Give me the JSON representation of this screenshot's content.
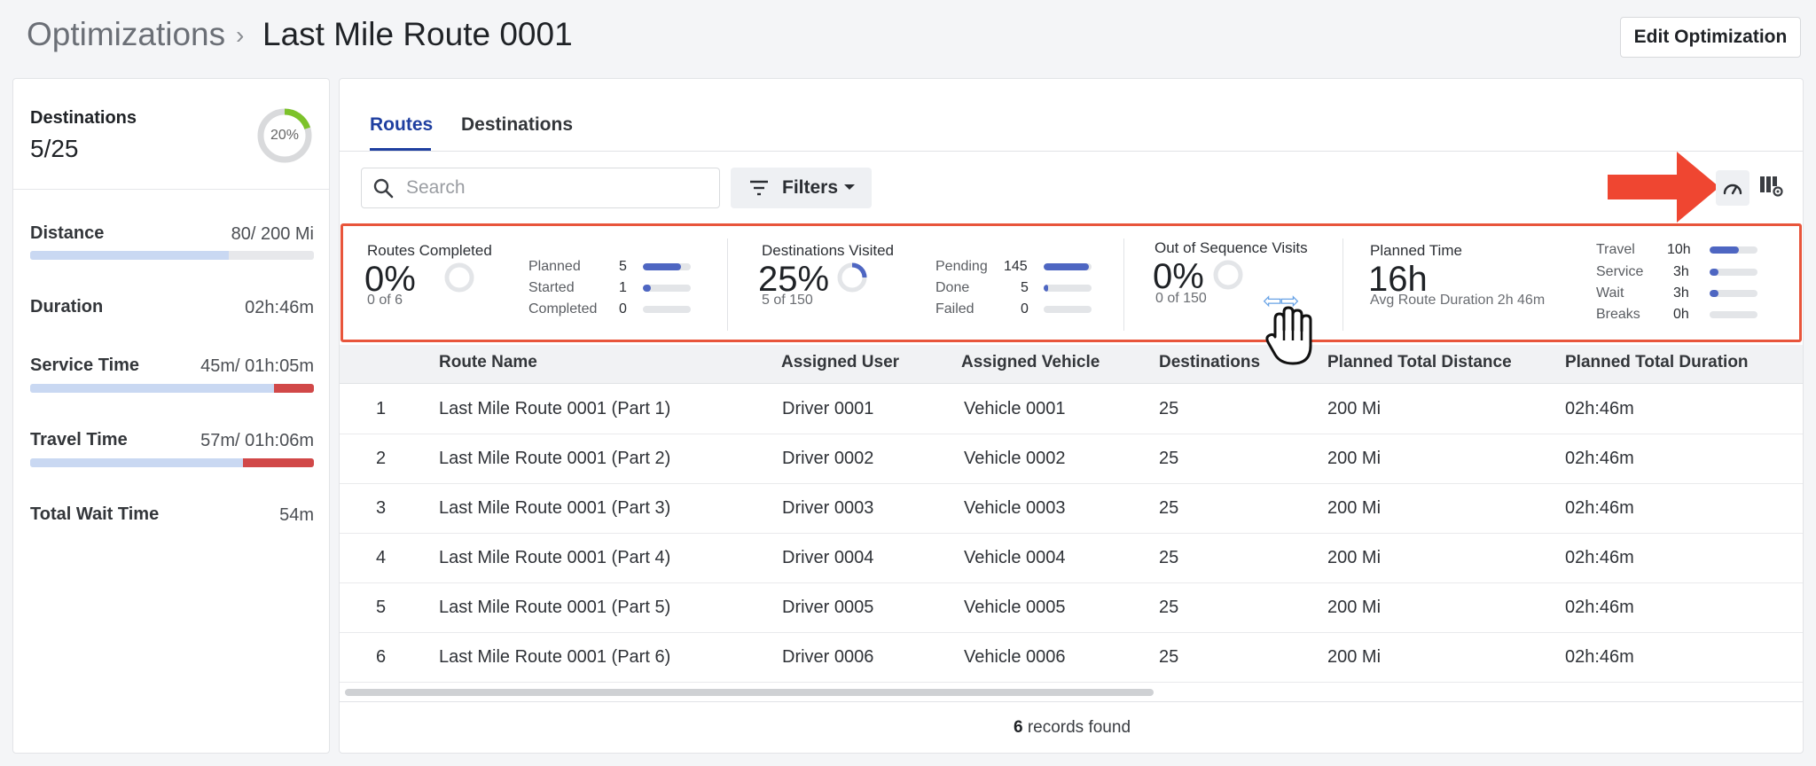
{
  "header": {
    "breadcrumb_root": "Optimizations",
    "breadcrumb_separator": "›",
    "breadcrumb_current": "Last Mile Route 0001",
    "edit_button": "Edit Optimization"
  },
  "left_panel": {
    "destinations_title": "Destinations",
    "destinations_value": "5/25",
    "destinations_percent_label": "20%",
    "destinations_progress": 0.2,
    "distance": {
      "label": "Distance",
      "value": "80/ 200 Mi",
      "progress": 0.7
    },
    "duration": {
      "label": "Duration",
      "value": "02h:46m"
    },
    "service_time": {
      "label": "Service Time",
      "value": "45m/ 01h:05m",
      "progress": 0.86
    },
    "travel_time": {
      "label": "Travel Time",
      "value": "57m/ 01h:06m",
      "progress": 0.75
    },
    "total_wait_time": {
      "label": "Total Wait Time",
      "value": "54m"
    }
  },
  "tabs": [
    {
      "label": "Routes",
      "active": true
    },
    {
      "label": "Destinations",
      "active": false
    }
  ],
  "toolbar": {
    "search_placeholder": "Search",
    "filters_label": "Filters"
  },
  "stats": {
    "routes_completed": {
      "title": "Routes Completed",
      "value": "0%",
      "sub": "0 of 6",
      "rows": [
        {
          "label": "Planned",
          "count": "5",
          "progress": 0.8
        },
        {
          "label": "Started",
          "count": "1",
          "progress": 0.17
        },
        {
          "label": "Completed",
          "count": "0",
          "progress": 0
        }
      ]
    },
    "destinations_visited": {
      "title": "Destinations Visited",
      "value": "25%",
      "sub": "5 of 150",
      "rows": [
        {
          "label": "Pending",
          "count": "145",
          "progress": 0.95
        },
        {
          "label": "Done",
          "count": "5",
          "progress": 0.1
        },
        {
          "label": "Failed",
          "count": "0",
          "progress": 0
        }
      ]
    },
    "out_of_sequence": {
      "title": "Out of Sequence Visits",
      "value": "0%",
      "sub": "0 of 150"
    },
    "planned_time": {
      "title": "Planned Time",
      "value": "16h",
      "sub": "Avg Route Duration 2h 46m",
      "rows": [
        {
          "label": "Travel",
          "count": "10h",
          "progress": 0.62
        },
        {
          "label": "Service",
          "count": "3h",
          "progress": 0.19
        },
        {
          "label": "Wait",
          "count": "3h",
          "progress": 0.19
        },
        {
          "label": "Breaks",
          "count": "0h",
          "progress": 0
        }
      ]
    }
  },
  "table": {
    "columns": [
      "Route Name",
      "Assigned User",
      "Assigned Vehicle",
      "Destinations",
      "Planned Total Distance",
      "Planned Total Duration"
    ],
    "rows": [
      {
        "index": "1",
        "route": "Last Mile Route 0001 (Part 1)",
        "user": "Driver 0001",
        "vehicle": "Vehicle 0001",
        "destinations": "25",
        "distance": "200 Mi",
        "duration": "02h:46m"
      },
      {
        "index": "2",
        "route": "Last Mile Route 0001 (Part 2)",
        "user": "Driver 0002",
        "vehicle": "Vehicle 0002",
        "destinations": "25",
        "distance": "200 Mi",
        "duration": "02h:46m"
      },
      {
        "index": "3",
        "route": "Last Mile Route 0001 (Part 3)",
        "user": "Driver 0003",
        "vehicle": "Vehicle 0003",
        "destinations": "25",
        "distance": "200 Mi",
        "duration": "02h:46m"
      },
      {
        "index": "4",
        "route": "Last Mile Route 0001 (Part 4)",
        "user": "Driver 0004",
        "vehicle": "Vehicle 0004",
        "destinations": "25",
        "distance": "200 Mi",
        "duration": "02h:46m"
      },
      {
        "index": "5",
        "route": "Last Mile Route 0001 (Part 5)",
        "user": "Driver 0005",
        "vehicle": "Vehicle 0005",
        "destinations": "25",
        "distance": "200 Mi",
        "duration": "02h:46m"
      },
      {
        "index": "6",
        "route": "Last Mile Route 0001 (Part 6)",
        "user": "Driver 0006",
        "vehicle": "Vehicle 0006",
        "destinations": "25",
        "distance": "200 Mi",
        "duration": "02h:46m"
      }
    ],
    "records_count": "6",
    "records_suffix": "records found"
  },
  "icons": {
    "search": "search-icon",
    "filters": "filter-lines-icon",
    "gauge": "speedometer-icon",
    "column_settings": "column-settings-icon",
    "pointer": "hand-cursor-icon",
    "annotation": "red-arrow-icon"
  },
  "colors": {
    "accent": "#1f3fa0",
    "bar_fill": "#4e66c2",
    "over_budget": "#d14848",
    "highlight_border": "#e8553b",
    "donut_green": "#7cc22a"
  }
}
